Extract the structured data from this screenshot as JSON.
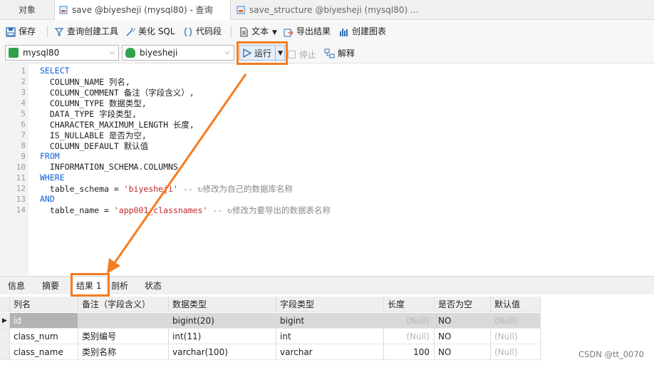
{
  "tabs": {
    "objects": "对象",
    "query_tab": "save @biyesheji (mysql80) - 查询",
    "structure_tab": "save_structure @biyesheji (mysql80) ..."
  },
  "toolbar": {
    "save": "保存",
    "query_builder": "查询创建工具",
    "beautify_sql": "美化 SQL",
    "snippet": "代码段",
    "text": "文本",
    "export_results": "导出结果",
    "create_chart": "创建图表"
  },
  "toolbar2": {
    "connection": "mysql80",
    "database": "biyesheji",
    "run": "运行",
    "stop": "停止",
    "explain": "解释"
  },
  "editor": {
    "line_numbers": [
      "1",
      "2",
      "3",
      "4",
      "5",
      "6",
      "7",
      "8",
      "9",
      "10",
      "11",
      "12",
      "13",
      "14"
    ],
    "lines": {
      "l1": "SELECT",
      "l2": "  COLUMN_NAME 列名,",
      "l3": "  COLUMN_COMMENT 备注（字段含义）,",
      "l4": "  COLUMN_TYPE 数据类型,",
      "l5": "  DATA_TYPE 字段类型,",
      "l6": "  CHARACTER_MAXIMUM_LENGTH 长度,",
      "l7": "  IS_NULLABLE 是否为空,",
      "l8": "  COLUMN_DEFAULT 默认值",
      "l9": "FROM",
      "l10": "  INFORMATION_SCHEMA.COLUMNS",
      "l11": "WHERE",
      "l12_a": "  table_schema = ",
      "l12_s": "'biyesheji'",
      "l12_c": " -- ↻修改为自己的数据库名称",
      "l13": "AND",
      "l14_a": "  table_name = ",
      "l14_s": "'app001_classnames'",
      "l14_c": " -- ↻修改为要导出的数据表名称"
    }
  },
  "bottom_tabs": {
    "info": "信息",
    "summary": "摘要",
    "result1": "结果 1",
    "profile": "剖析",
    "status": "状态"
  },
  "grid": {
    "headers": [
      "列名",
      "备注（字段含义）",
      "数据类型",
      "字段类型",
      "长度",
      "是否为空",
      "默认值"
    ],
    "rows": [
      [
        "id",
        "",
        "bigint(20)",
        "bigint",
        "(Null)",
        "NO",
        "(Null)"
      ],
      [
        "class_num",
        "类别编号",
        "int(11)",
        "int",
        "(Null)",
        "NO",
        "(Null)"
      ],
      [
        "class_name",
        "类别名称",
        "varchar(100)",
        "varchar",
        "100",
        "NO",
        "(Null)"
      ]
    ]
  },
  "watermark": "CSDN @tt_0070",
  "colors": {
    "accent_orange": "#f47c20",
    "keyword_blue": "#0e5fd8",
    "string_red": "#c0292b"
  }
}
